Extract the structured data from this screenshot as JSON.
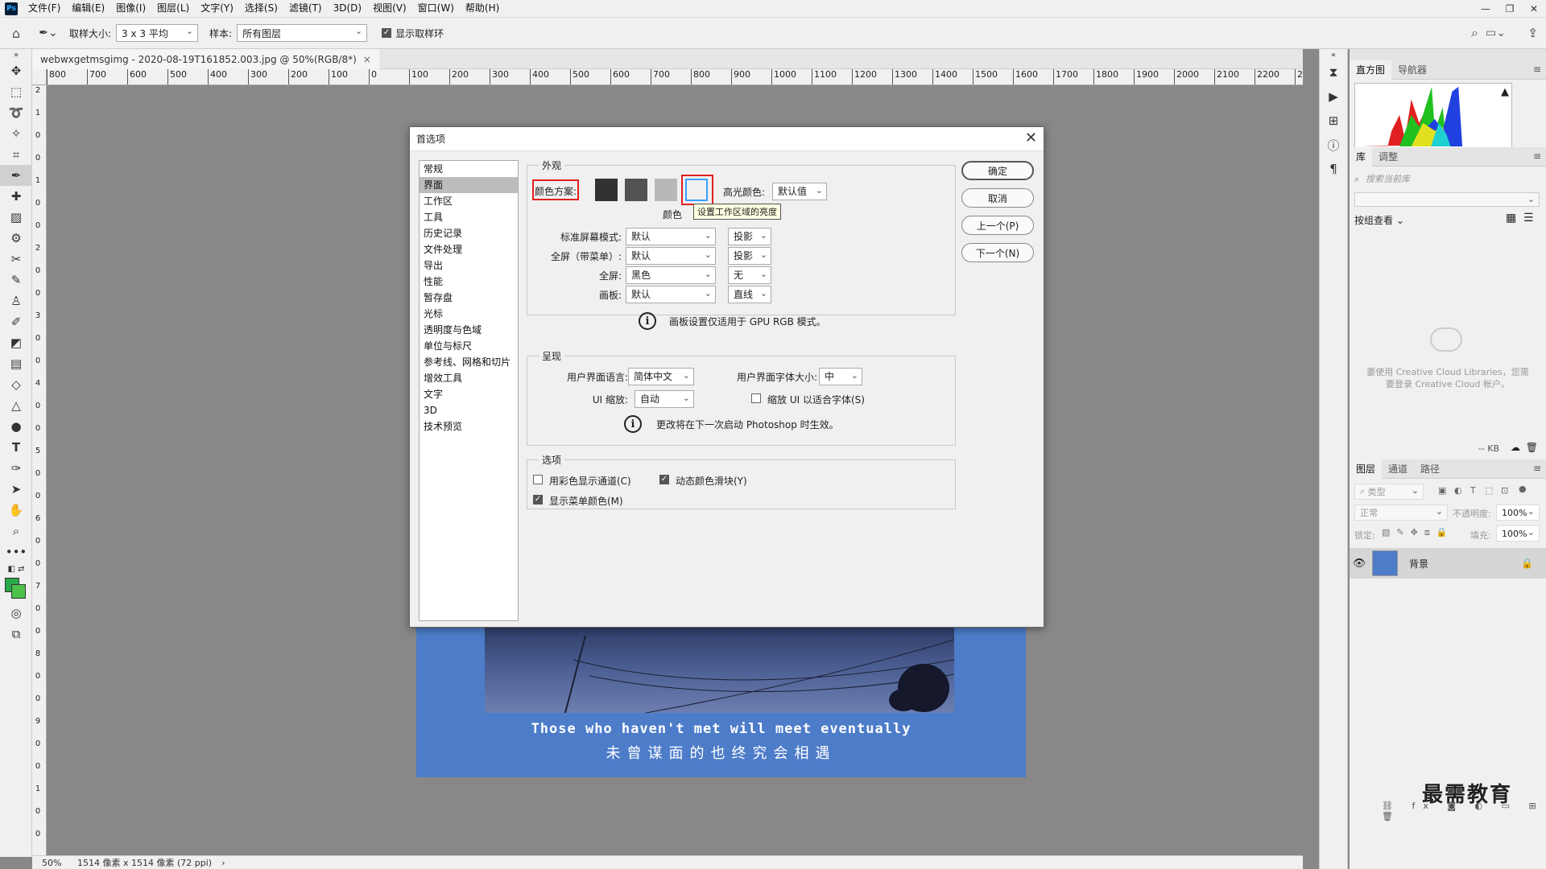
{
  "app": {
    "logo": "Ps"
  },
  "menu": [
    "文件(F)",
    "编辑(E)",
    "图像(I)",
    "图层(L)",
    "文字(Y)",
    "选择(S)",
    "滤镜(T)",
    "3D(D)",
    "视图(V)",
    "窗口(W)",
    "帮助(H)"
  ],
  "window_controls": [
    "—",
    "❐",
    "✕"
  ],
  "options": {
    "sample_size_label": "取样大小:",
    "sample_size_value": "3 x 3 平均",
    "sample_label": "样本:",
    "sample_value": "所有图层",
    "show_ring_label": "显示取样环",
    "show_ring_checked": true
  },
  "document": {
    "tab_title": "webwxgetmsgimg - 2020-08-19T161852.003.jpg @ 50%(RGB/8*)",
    "tab_close": "×",
    "caption_en": "Those who haven't met will meet eventually",
    "caption_zh": "未曾谋面的也终究会相遇"
  },
  "ruler_top": [
    "800",
    "700",
    "600",
    "500",
    "400",
    "300",
    "200",
    "100",
    "0",
    "100",
    "200",
    "300",
    "400",
    "500",
    "600",
    "700",
    "800",
    "900",
    "1000",
    "1100",
    "1200",
    "1300",
    "1400",
    "1500",
    "1600",
    "1700",
    "1800",
    "1900",
    "2000",
    "2100",
    "2200",
    "2"
  ],
  "ruler_left": [
    "2",
    "1",
    "0",
    "0",
    "1",
    "0",
    "0",
    "2",
    "0",
    "0",
    "3",
    "0",
    "0",
    "4",
    "0",
    "0",
    "5",
    "0",
    "0",
    "6",
    "0",
    "0",
    "7",
    "0",
    "0",
    "8",
    "0",
    "0",
    "9",
    "0",
    "0",
    "1",
    "0",
    "0"
  ],
  "status": {
    "zoom": "50%",
    "info": "1514 像素 x 1514 像素 (72 ppi)",
    "arrow": "›"
  },
  "panels": {
    "histogram_tabs": [
      "直方图",
      "导航器"
    ],
    "library_tabs": [
      "库",
      "调整"
    ],
    "library_search_placeholder": "搜索当前库",
    "group_view": "按组查看",
    "library_message": "要使用 Creative Cloud Libraries，您需要登录 Creative Cloud 帐户。",
    "kb": "-- KB",
    "layers_tabs": [
      "图层",
      "通道",
      "路径"
    ],
    "layer_filter": "类型",
    "blend_mode": "正常",
    "opacity_label": "不透明度:",
    "opacity_value": "100%",
    "lock_label": "锁定:",
    "fill_label": "填充:",
    "fill_value": "100%",
    "layer_name": "背景",
    "watermark": "最需教育"
  },
  "dialog": {
    "title": "首选项",
    "close": "✕",
    "nav": [
      "常规",
      "界面",
      "工作区",
      "工具",
      "历史记录",
      "文件处理",
      "导出",
      "性能",
      "暂存盘",
      "光标",
      "透明度与色域",
      "单位与标尺",
      "参考线、网格和切片",
      "增效工具",
      "文字",
      "3D",
      "技术预览"
    ],
    "nav_selected_index": 1,
    "appearance": {
      "title": "外观",
      "color_scheme_label": "颜色方案:",
      "swatch_colors": [
        "#323232",
        "#535353",
        "#b8b8b8",
        "#f0f0f0"
      ],
      "color_caption": "颜色",
      "tooltip": "设置工作区域的亮度",
      "highlight_label": "高光颜色:",
      "highlight_value": "默认值",
      "std_screen_label": "标准屏幕模式:",
      "std_screen_value": "默认",
      "std_screen_shadow": "投影",
      "fullmenu_label": "全屏（带菜单）:",
      "fullmenu_value": "默认",
      "fullmenu_shadow": "投影",
      "full_label": "全屏:",
      "full_value": "黑色",
      "full_shadow": "无",
      "artboard_label": "画板:",
      "artboard_value": "默认",
      "artboard_shadow": "直线",
      "note": "画板设置仅适用于 GPU RGB 模式。"
    },
    "presentation": {
      "title": "呈现",
      "lang_label": "用户界面语言:",
      "lang_value": "简体中文",
      "font_size_label": "用户界面字体大小:",
      "font_size_value": "中",
      "ui_scale_label": "UI 缩放:",
      "ui_scale_value": "自动",
      "scale_font_label": "缩放 UI 以适合字体(S)",
      "scale_font_checked": false,
      "note": "更改将在下一次启动 Photoshop 时生效。"
    },
    "options": {
      "title": "选项",
      "color_channels_label": "用彩色显示通道(C)",
      "color_channels_checked": false,
      "dynamic_sliders_label": "动态颜色滑块(Y)",
      "dynamic_sliders_checked": true,
      "menu_colors_label": "显示菜单颜色(M)",
      "menu_colors_checked": true
    },
    "buttons": {
      "ok": "确定",
      "cancel": "取消",
      "prev": "上一个(P)",
      "next": "下一个(N)"
    }
  },
  "colors": {
    "poster_blue": "#4d7cc9",
    "highlight_red": "#e02020",
    "tooltip_bg": "#ffffe1"
  }
}
